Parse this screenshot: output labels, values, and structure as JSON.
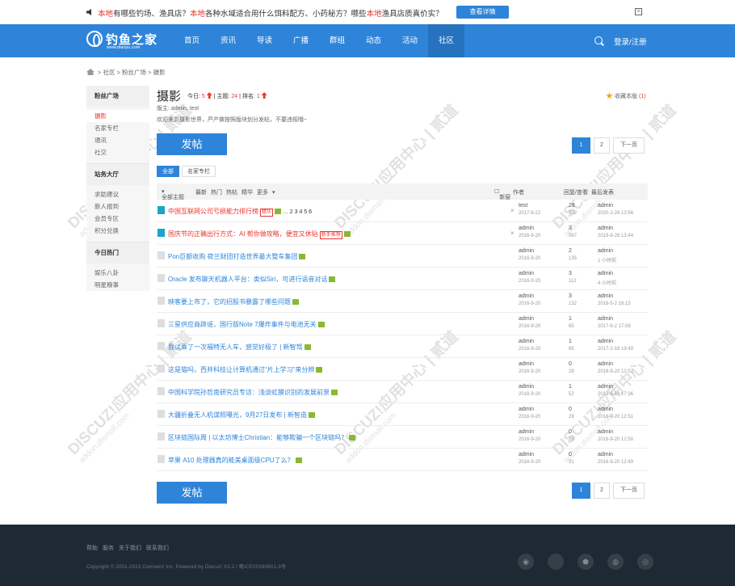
{
  "notice": {
    "segments": [
      {
        "text": "本地",
        "red": true
      },
      {
        "text": "有哪些钓场、渔具店？",
        "red": false
      },
      {
        "text": "本地",
        "red": true
      },
      {
        "text": "各种水域适合用什么饵料配方、小药秘方？哪些",
        "red": false
      },
      {
        "text": "本地",
        "red": true
      },
      {
        "text": "渔具店质真价实？",
        "red": false
      }
    ],
    "button": "查看详情",
    "close": "×"
  },
  "logo": {
    "name": "钓鱼之家",
    "url": "www.diaoyu.com"
  },
  "nav": {
    "items": [
      "首页",
      "资讯",
      "导读",
      "广播",
      "群组",
      "动态",
      "活动",
      "社区"
    ],
    "active": "社区",
    "login": "登录/注册"
  },
  "breadcrumb": [
    "社区",
    "粉丝广场",
    "摄影"
  ],
  "sidebar": {
    "groups": [
      {
        "title": "粉丝广场",
        "items": [
          "摄影",
          "名家专栏",
          "通讯",
          "社交"
        ],
        "active": "摄影"
      },
      {
        "title": "站务大厅",
        "items": [
          "求助建议",
          "新人报到",
          "会员专区",
          "积分兑换"
        ]
      },
      {
        "title": "今日热门",
        "items": [
          "娱乐八卦",
          "明星糗事"
        ]
      }
    ]
  },
  "forum": {
    "title": "摄影",
    "today_label": "今日:",
    "today": "5",
    "topics_label": "主题:",
    "topics": "24",
    "rank_label": "排名:",
    "rank": "1",
    "moderators": "版主: admin, test",
    "description": "欢迎来到摄影世界，严产做按照版块划分发帖，不要违规哦~",
    "favorite_label": "收藏本版",
    "favorite_count": "(1)"
  },
  "post_button": "发帖",
  "pager": {
    "current": "1",
    "pages": [
      "2"
    ],
    "next": "下一页"
  },
  "tabs": [
    "全部",
    "名家专栏"
  ],
  "table_header": {
    "filter": "全部主题",
    "sorts": [
      "最新",
      "热门",
      "热帖",
      "精华",
      "更多"
    ],
    "new_window": "新窗",
    "author": "作者",
    "replies": "回复/查看",
    "last": "最后发表"
  },
  "threads": [
    {
      "title": "中国互联网公司亏损能力排行榜",
      "red": true,
      "top": true,
      "tag": "精华",
      "img": true,
      "pages": "... 2 3 4 5 6",
      "x": true,
      "author": "test",
      "date": "2017-6-22",
      "replies": "28",
      "views": "902",
      "last_author": "admin",
      "last_date": "2020-2-26 13:56"
    },
    {
      "title": "国庆节的正确出行方式：AI 帮你做攻略，便宜又休贴",
      "red": true,
      "top": true,
      "tag": "新手推荐",
      "img": true,
      "pages": "",
      "x": true,
      "author": "admin",
      "date": "2016-9-20",
      "replies": "3",
      "views": "397",
      "last_author": "admin",
      "last_date": "2019-8-28 13:44"
    },
    {
      "title": "Pon巨额收购 荷兰财团打造世界最大整车集团",
      "red": false,
      "top": false,
      "tag": "",
      "img": true,
      "pages": "",
      "x": false,
      "author": "admin",
      "date": "2016-9-20",
      "replies": "2",
      "views": "135",
      "last_author": "admin",
      "last_date": "1 小时前"
    },
    {
      "title": "Oracle 发布聊天机器人平台：类似Siri，可进行语音对话",
      "red": false,
      "top": false,
      "tag": "",
      "img": true,
      "pages": "",
      "x": false,
      "author": "admin",
      "date": "2016-9-20",
      "replies": "3",
      "views": "112",
      "last_author": "admin",
      "last_date": "4 小时前"
    },
    {
      "title": "映客要上市了，它的招股书暴露了哪些问题",
      "red": false,
      "top": false,
      "tag": "",
      "img": true,
      "pages": "",
      "x": false,
      "author": "admin",
      "date": "2016-9-20",
      "replies": "3",
      "views": "132",
      "last_author": "admin",
      "last_date": "2018-5-2 18:15"
    },
    {
      "title": "三星供应商辟谣，国行版Note 7爆炸事件与电池无关",
      "red": false,
      "top": false,
      "tag": "",
      "img": true,
      "pages": "",
      "x": false,
      "author": "admin",
      "date": "2016-9-20",
      "replies": "1",
      "views": "65",
      "last_author": "admin",
      "last_date": "2017-6-2 17:08"
    },
    {
      "title": "我试乘了一次福特无人车，感觉好极了 | 新智驾",
      "red": false,
      "top": false,
      "tag": "",
      "img": true,
      "pages": "",
      "x": false,
      "author": "admin",
      "date": "2016-9-20",
      "replies": "1",
      "views": "65",
      "last_author": "admin",
      "last_date": "2017-2-18 19:49"
    },
    {
      "title": "这是猫吗，西井科技让计算机通过“片上学习”来分辨",
      "red": false,
      "top": false,
      "tag": "",
      "img": true,
      "pages": "",
      "x": false,
      "author": "admin",
      "date": "2016-9-20",
      "replies": "0",
      "views": "29",
      "last_author": "admin",
      "last_date": "2016-9-20 12:52"
    },
    {
      "title": "中国科学院孙哲南研究员专访：浅谈虹膜识别的发展前景",
      "red": false,
      "top": false,
      "tag": "",
      "img": true,
      "pages": "",
      "x": false,
      "author": "admin",
      "date": "2016-9-20",
      "replies": "1",
      "views": "52",
      "last_author": "admin",
      "last_date": "2019-6-10 17:36"
    },
    {
      "title": "大疆折叠无人机谍照曝光，9月27日发布 | 新智造",
      "red": false,
      "top": false,
      "tag": "",
      "img": true,
      "pages": "",
      "x": false,
      "author": "admin",
      "date": "2016-9-20",
      "replies": "0",
      "views": "29",
      "last_author": "admin",
      "last_date": "2016-9-20 12:51"
    },
    {
      "title": "区块链国际周 | 以太坊博士Christian：能够欺骗一个区块链吗？",
      "red": false,
      "top": false,
      "tag": "",
      "img": true,
      "pages": "",
      "x": false,
      "author": "admin",
      "date": "2016-9-20",
      "replies": "0",
      "views": "26",
      "last_author": "admin",
      "last_date": "2016-9-20 12:50"
    },
    {
      "title": "苹果 A10 处理器真的能美桌面级CPU了么？",
      "red": false,
      "top": false,
      "tag": "",
      "img": true,
      "pages": "",
      "x": false,
      "author": "admin",
      "date": "2016-9-20",
      "replies": "0",
      "views": "31",
      "last_author": "admin",
      "last_date": "2016-9-20 12:49"
    }
  ],
  "footer": {
    "links": [
      "帮助",
      "服务",
      "关于我们",
      "联系我们"
    ],
    "copyright": "Copyright © 2001-2013 Comsenz Inc. Powered by Discuz! X3.2 / 粤ICP20160801-3号",
    "social_icons": [
      "wechat-icon",
      "apple-icon",
      "android-icon",
      "weibo-icon",
      "rss-icon"
    ]
  },
  "watermark": {
    "main": "DISCUZ!应用中心 | 贰道",
    "sub": "addon.dismall.com"
  }
}
